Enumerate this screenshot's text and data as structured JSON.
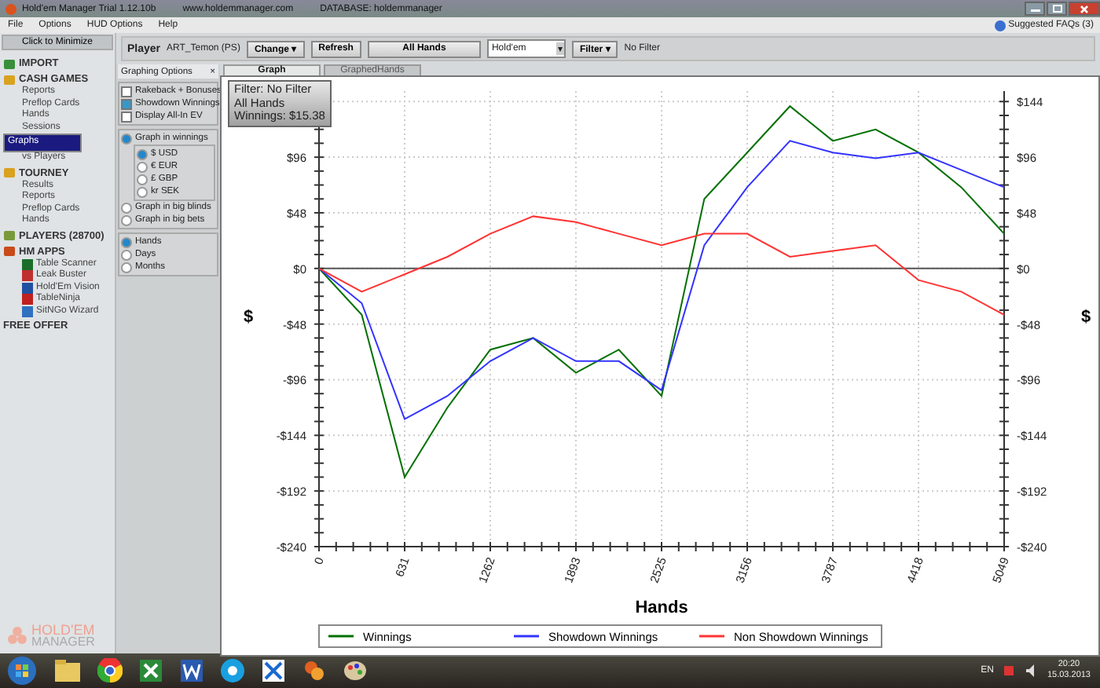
{
  "window": {
    "title": "Hold'em Manager Trial 1.12.10b",
    "url": "www.holdemmanager.com",
    "database": "DATABASE: holdemmanager"
  },
  "menu": [
    "File",
    "Options",
    "HUD Options",
    "Help"
  ],
  "suggested_faqs": "Suggested FAQs (3)",
  "sidebar": {
    "minimize": "Click to Minimize",
    "sections": [
      {
        "label": "IMPORT",
        "kind": "import"
      },
      {
        "label": "CASH GAMES",
        "kind": "cash",
        "children": [
          {
            "label": "Reports",
            "selected": false
          },
          {
            "label": "Preflop Cards",
            "selected": false
          },
          {
            "label": "Hands",
            "selected": false
          },
          {
            "label": "Sessions",
            "selected": false
          },
          {
            "label": "Graphs",
            "selected": true
          },
          {
            "label": "vs Players",
            "selected": false
          }
        ]
      },
      {
        "label": "TOURNEY",
        "kind": "tourney",
        "children": [
          {
            "label": "Results",
            "selected": false
          },
          {
            "label": "Reports",
            "selected": false
          },
          {
            "label": "Preflop Cards",
            "selected": false
          },
          {
            "label": "Hands",
            "selected": false
          }
        ]
      },
      {
        "label": "PLAYERS (28700)",
        "kind": "players"
      },
      {
        "label": "HM APPS",
        "kind": "apps",
        "children": [
          {
            "label": "Table Scanner",
            "selected": false
          },
          {
            "label": "Leak Buster",
            "selected": false
          },
          {
            "label": "Hold'Em Vision",
            "selected": false
          },
          {
            "label": "TableNinja",
            "selected": false
          },
          {
            "label": "SitNGo Wizard",
            "selected": false
          }
        ]
      },
      {
        "label": "FREE OFFER",
        "kind": "plain"
      }
    ],
    "logo": [
      "HOLD'EM",
      "MANAGER"
    ]
  },
  "toolbar": {
    "player_label": "Player",
    "player": "ART_Temon (PS)",
    "change": "Change",
    "change_arrow": "▾",
    "refresh": "Refresh",
    "all_hands": "All Hands",
    "game": "Hold'em",
    "game_arrow": "▾",
    "filter": "Filter",
    "filter_arrow": "▾",
    "filter_text": "No Filter"
  },
  "options": {
    "title": "Graphing Options",
    "close": "×",
    "checks": [
      {
        "label": "Rakeback + Bonuses",
        "checked": false
      },
      {
        "label": "Showdown Winnings",
        "checked": true
      },
      {
        "label": "Display All-In EV",
        "checked": false
      }
    ],
    "units": [
      {
        "label": "Graph in winnings",
        "selected": true,
        "children": [
          {
            "label": "$ USD",
            "selected": true
          },
          {
            "label": "€ EUR",
            "selected": false
          },
          {
            "label": "£ GBP",
            "selected": false
          },
          {
            "label": "kr SEK",
            "selected": false
          }
        ]
      },
      {
        "label": "Graph in big blinds",
        "selected": false
      },
      {
        "label": "Graph in big bets",
        "selected": false
      }
    ],
    "axis": [
      {
        "label": "Hands",
        "selected": true
      },
      {
        "label": "Days",
        "selected": false
      },
      {
        "label": "Months",
        "selected": false
      }
    ]
  },
  "tabs": [
    {
      "label": "Graph",
      "selected": true
    },
    {
      "label": "GraphedHands",
      "selected": false
    }
  ],
  "overlay": [
    "Filter: No Filter",
    "All Hands",
    "Winnings: $15.38"
  ],
  "chart": {
    "chart_data": {
      "type": "line",
      "xlabel": "Hands",
      "ylabel": "$",
      "x": [
        0,
        315,
        631,
        946,
        1262,
        1578,
        1893,
        2209,
        2525,
        2840,
        3156,
        3471,
        3787,
        4102,
        4418,
        4733,
        5049
      ],
      "series": [
        {
          "name": "Winnings",
          "color": "#007000",
          "values": [
            0,
            -40,
            -180,
            -120,
            -70,
            -60,
            -90,
            -70,
            -110,
            60,
            100,
            140,
            110,
            120,
            100,
            70,
            30
          ]
        },
        {
          "name": "Showdown Winnings",
          "color": "#3333ff",
          "values": [
            0,
            -30,
            -130,
            -110,
            -80,
            -60,
            -80,
            -80,
            -105,
            20,
            70,
            110,
            100,
            95,
            100,
            85,
            70
          ]
        },
        {
          "name": "Non Showdown Winnings",
          "color": "#ff3333",
          "values": [
            0,
            -20,
            -5,
            10,
            30,
            45,
            40,
            30,
            20,
            30,
            30,
            10,
            15,
            20,
            -10,
            -20,
            -40
          ]
        }
      ],
      "xlim": [
        0,
        5049
      ],
      "ylim": [
        -240,
        153
      ],
      "grid": true,
      "legend": true,
      "xticks": [
        0,
        631,
        1262,
        1893,
        2525,
        3156,
        3787,
        4418,
        5049
      ],
      "yticks": [
        {
          "value": -240,
          "label": "-$240"
        },
        {
          "value": -192,
          "label": "-$192"
        },
        {
          "value": -144,
          "label": "-$144"
        },
        {
          "value": -96,
          "label": "-$96"
        },
        {
          "value": -48,
          "label": "-$48"
        },
        {
          "value": 0,
          "label": "$0"
        },
        {
          "value": 48,
          "label": "$48"
        },
        {
          "value": 96,
          "label": "$96"
        },
        {
          "value": 144,
          "label": "$144"
        }
      ]
    }
  },
  "taskbar": {
    "language": "EN",
    "time": "20:20",
    "date": "15.03.2013"
  }
}
